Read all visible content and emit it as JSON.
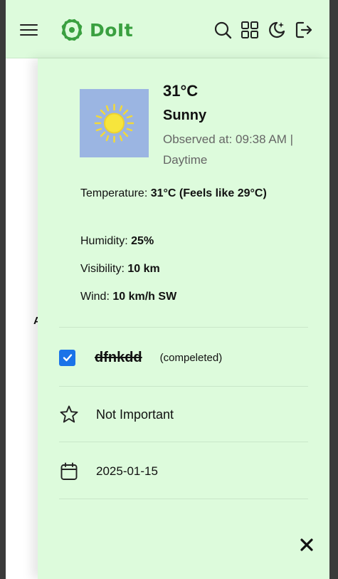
{
  "header": {
    "app_name": "DoIt",
    "icons": [
      "menu-icon",
      "logo-icon",
      "search-icon",
      "grid-view-icon",
      "theme-toggle-icon",
      "logout-icon"
    ]
  },
  "background": {
    "partial_text": "A"
  },
  "weather": {
    "icon": "sun-icon",
    "temperature": "31°C",
    "condition": "Sunny",
    "observed": "Observed at: 09:38 AM | Daytime",
    "stats": [
      {
        "label": "Temperature:",
        "value": "31°C (Feels like 29°C)"
      },
      {
        "label": "Humidity:",
        "value": "25%"
      },
      {
        "label": "Visibility:",
        "value": "10 km"
      },
      {
        "label": "Wind:",
        "value": "10 km/h SW"
      }
    ]
  },
  "task": {
    "title": "dfnkdd",
    "status": "(compeleted)",
    "completed": true,
    "importance": "Not Important",
    "due_date": "2025-01-15"
  },
  "colors": {
    "panel_bg": "#ddfbdc",
    "brand_green": "#3aa040",
    "checkbox_blue": "#1a73e8",
    "weather_img_bg": "#9bb5e2"
  }
}
